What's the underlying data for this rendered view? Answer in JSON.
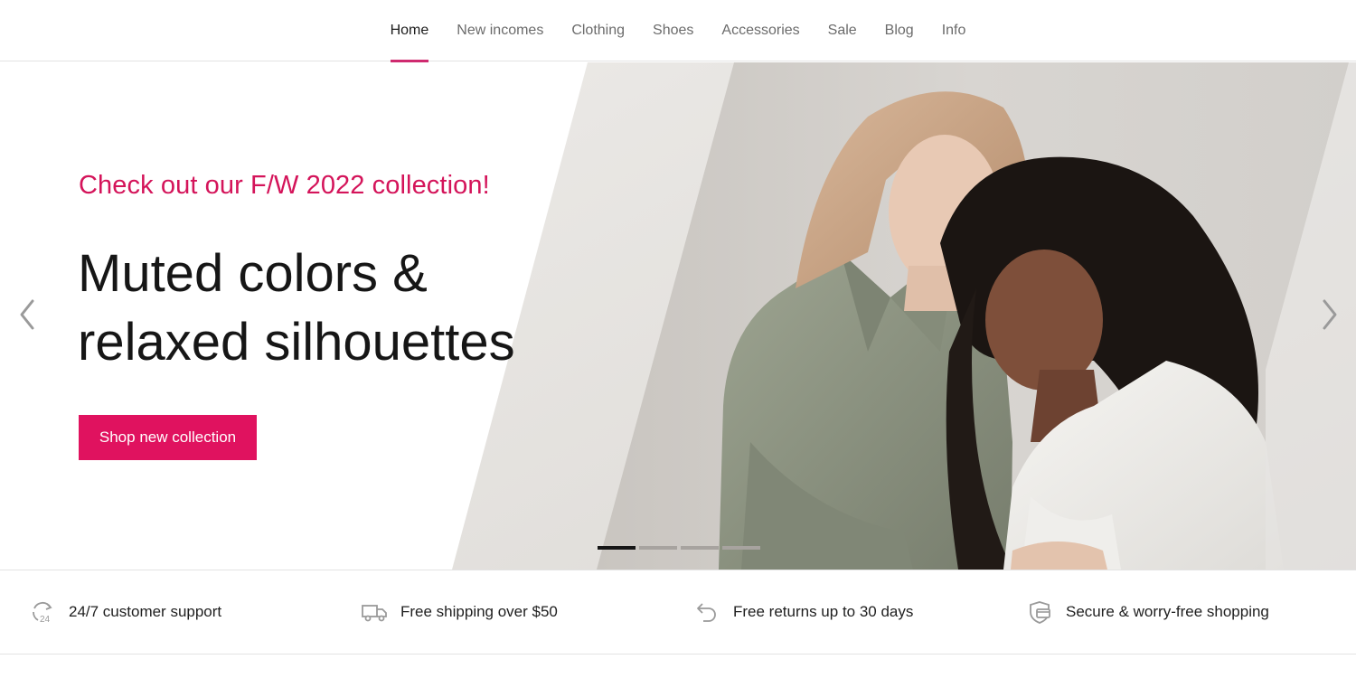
{
  "nav": {
    "items": [
      {
        "label": "Home",
        "active": true
      },
      {
        "label": "New incomes",
        "active": false
      },
      {
        "label": "Clothing",
        "active": false
      },
      {
        "label": "Shoes",
        "active": false
      },
      {
        "label": "Accessories",
        "active": false
      },
      {
        "label": "Sale",
        "active": false
      },
      {
        "label": "Blog",
        "active": false
      },
      {
        "label": "Info",
        "active": false
      }
    ]
  },
  "hero": {
    "eyebrow": "Check out our F/W 2022 collection!",
    "headline_line1": "Muted colors &",
    "headline_line2": "relaxed silhouettes",
    "cta_label": "Shop new collection",
    "prev_icon": "chevron-left-icon",
    "next_icon": "chevron-right-icon",
    "slides_count": 4,
    "active_slide": 1
  },
  "features": [
    {
      "icon": "support-24-icon",
      "label": "24/7 customer support"
    },
    {
      "icon": "truck-icon",
      "label": "Free shipping over $50"
    },
    {
      "icon": "return-arrow-icon",
      "label": "Free returns up to 30 days"
    },
    {
      "icon": "shield-card-icon",
      "label": "Secure & worry-free shopping"
    }
  ],
  "colors": {
    "accent": "#d4145a",
    "button": "#e0125f",
    "nav_underline": "#cf2a6f"
  }
}
